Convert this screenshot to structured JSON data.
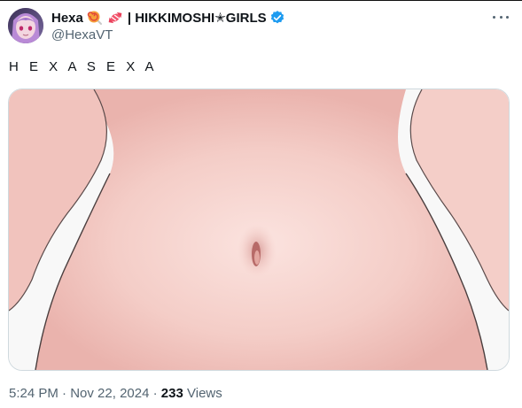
{
  "tweet": {
    "display_name": "Hexa",
    "name_suffix": "| HIKKIMOSHI✭GIRLS",
    "handle": "@HexaVT",
    "text": "H E X A S E X A",
    "time": "5:24 PM",
    "date": "Nov 22, 2024",
    "dot": "·",
    "views_count": "233",
    "views_label": "Views",
    "icons": [
      "lollipop-emoji",
      "candy-emoji",
      "verified-badge-icon",
      "more-options-icon"
    ],
    "colors": {
      "verified": "#1d9bf0",
      "secondary_text": "#536471",
      "border": "#cfd9de"
    }
  }
}
